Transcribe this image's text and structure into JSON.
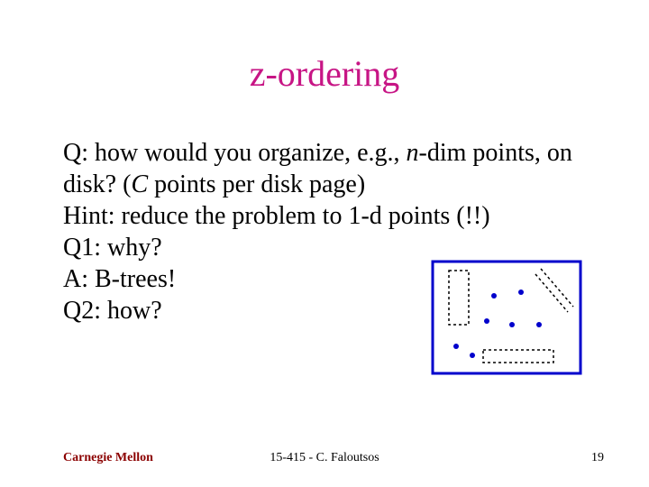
{
  "title": "z-ordering",
  "body": {
    "q_prefix": "Q: how would you organize, e.g., ",
    "q_dim": "n",
    "q_mid": "-dim points, on disk? (",
    "q_c": "C",
    "q_suffix": " points per disk page)",
    "hint": "Hint: reduce the problem to 1-d points (!!)",
    "q1": "Q1: why?",
    "a": "A: B-trees!",
    "q2": "Q2: how?"
  },
  "footer": {
    "left": "Carnegie Mellon",
    "center": "15-415 - C. Faloutsos",
    "right": "19"
  },
  "diagram": {
    "border_color": "#0000cc",
    "dot_color": "#0000cc",
    "dash_color": "#000000"
  }
}
